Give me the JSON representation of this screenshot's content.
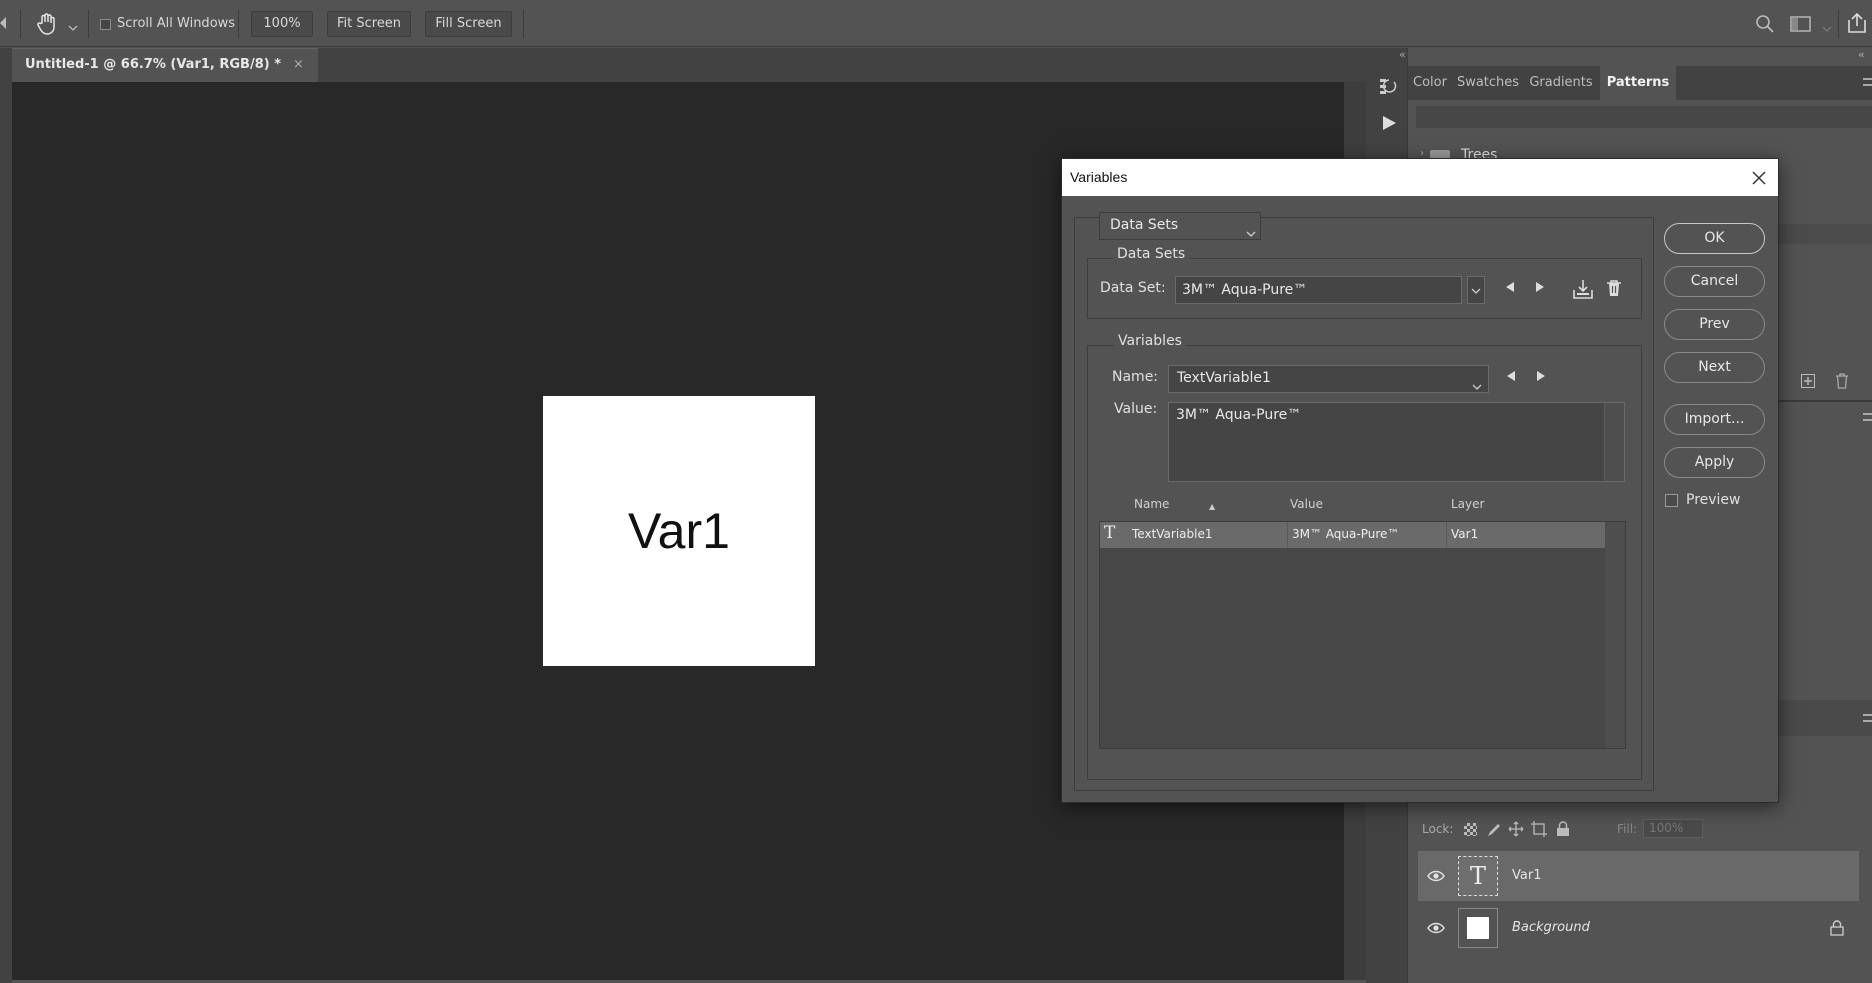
{
  "toolbar": {
    "scroll_all_windows_label": "Scroll All Windows",
    "zoom_value": "100%",
    "fit_screen_label": "Fit Screen",
    "fill_screen_label": "Fill Screen"
  },
  "document": {
    "tab_title": "Untitled-1 @ 66.7% (Var1, RGB/8) *",
    "tab_close": "×",
    "canvas_text": "Var1"
  },
  "panels": {
    "tabs": [
      "Color",
      "Swatches",
      "Gradients",
      "Patterns"
    ],
    "active_tab": "Patterns",
    "pattern_group_label": "Trees"
  },
  "dialog": {
    "title": "Variables",
    "mode_select": "Data Sets",
    "datasets_group_label": "Data Sets",
    "dataset_label": "Data Set:",
    "dataset_value": "3M™ Aqua-Pure™",
    "variables_group_label": "Variables",
    "name_label": "Name:",
    "name_value": "TextVariable1",
    "value_label": "Value:",
    "value_text": "3M™ Aqua-Pure™",
    "table": {
      "headers": [
        "Name",
        "Value",
        "Layer"
      ],
      "rows": [
        {
          "name": "TextVariable1",
          "value": "3M™ Aqua-Pure™",
          "layer": "Var1"
        }
      ]
    },
    "buttons": {
      "ok": "OK",
      "cancel": "Cancel",
      "prev": "Prev",
      "next": "Next",
      "import": "Import...",
      "apply": "Apply"
    },
    "preview_label": "Preview"
  },
  "layers": {
    "lock_label": "Lock:",
    "fill_label": "Fill:",
    "fill_value": "100%",
    "items": [
      {
        "name": "Var1",
        "type": "text",
        "thumb_glyph": "T"
      },
      {
        "name": "Background",
        "type": "background"
      }
    ]
  },
  "colors": {
    "app_bg": "#535353",
    "canvas_bg": "#282828",
    "dialog_title_bg": "#ffffff",
    "selected_row": "#6a6a6a"
  }
}
